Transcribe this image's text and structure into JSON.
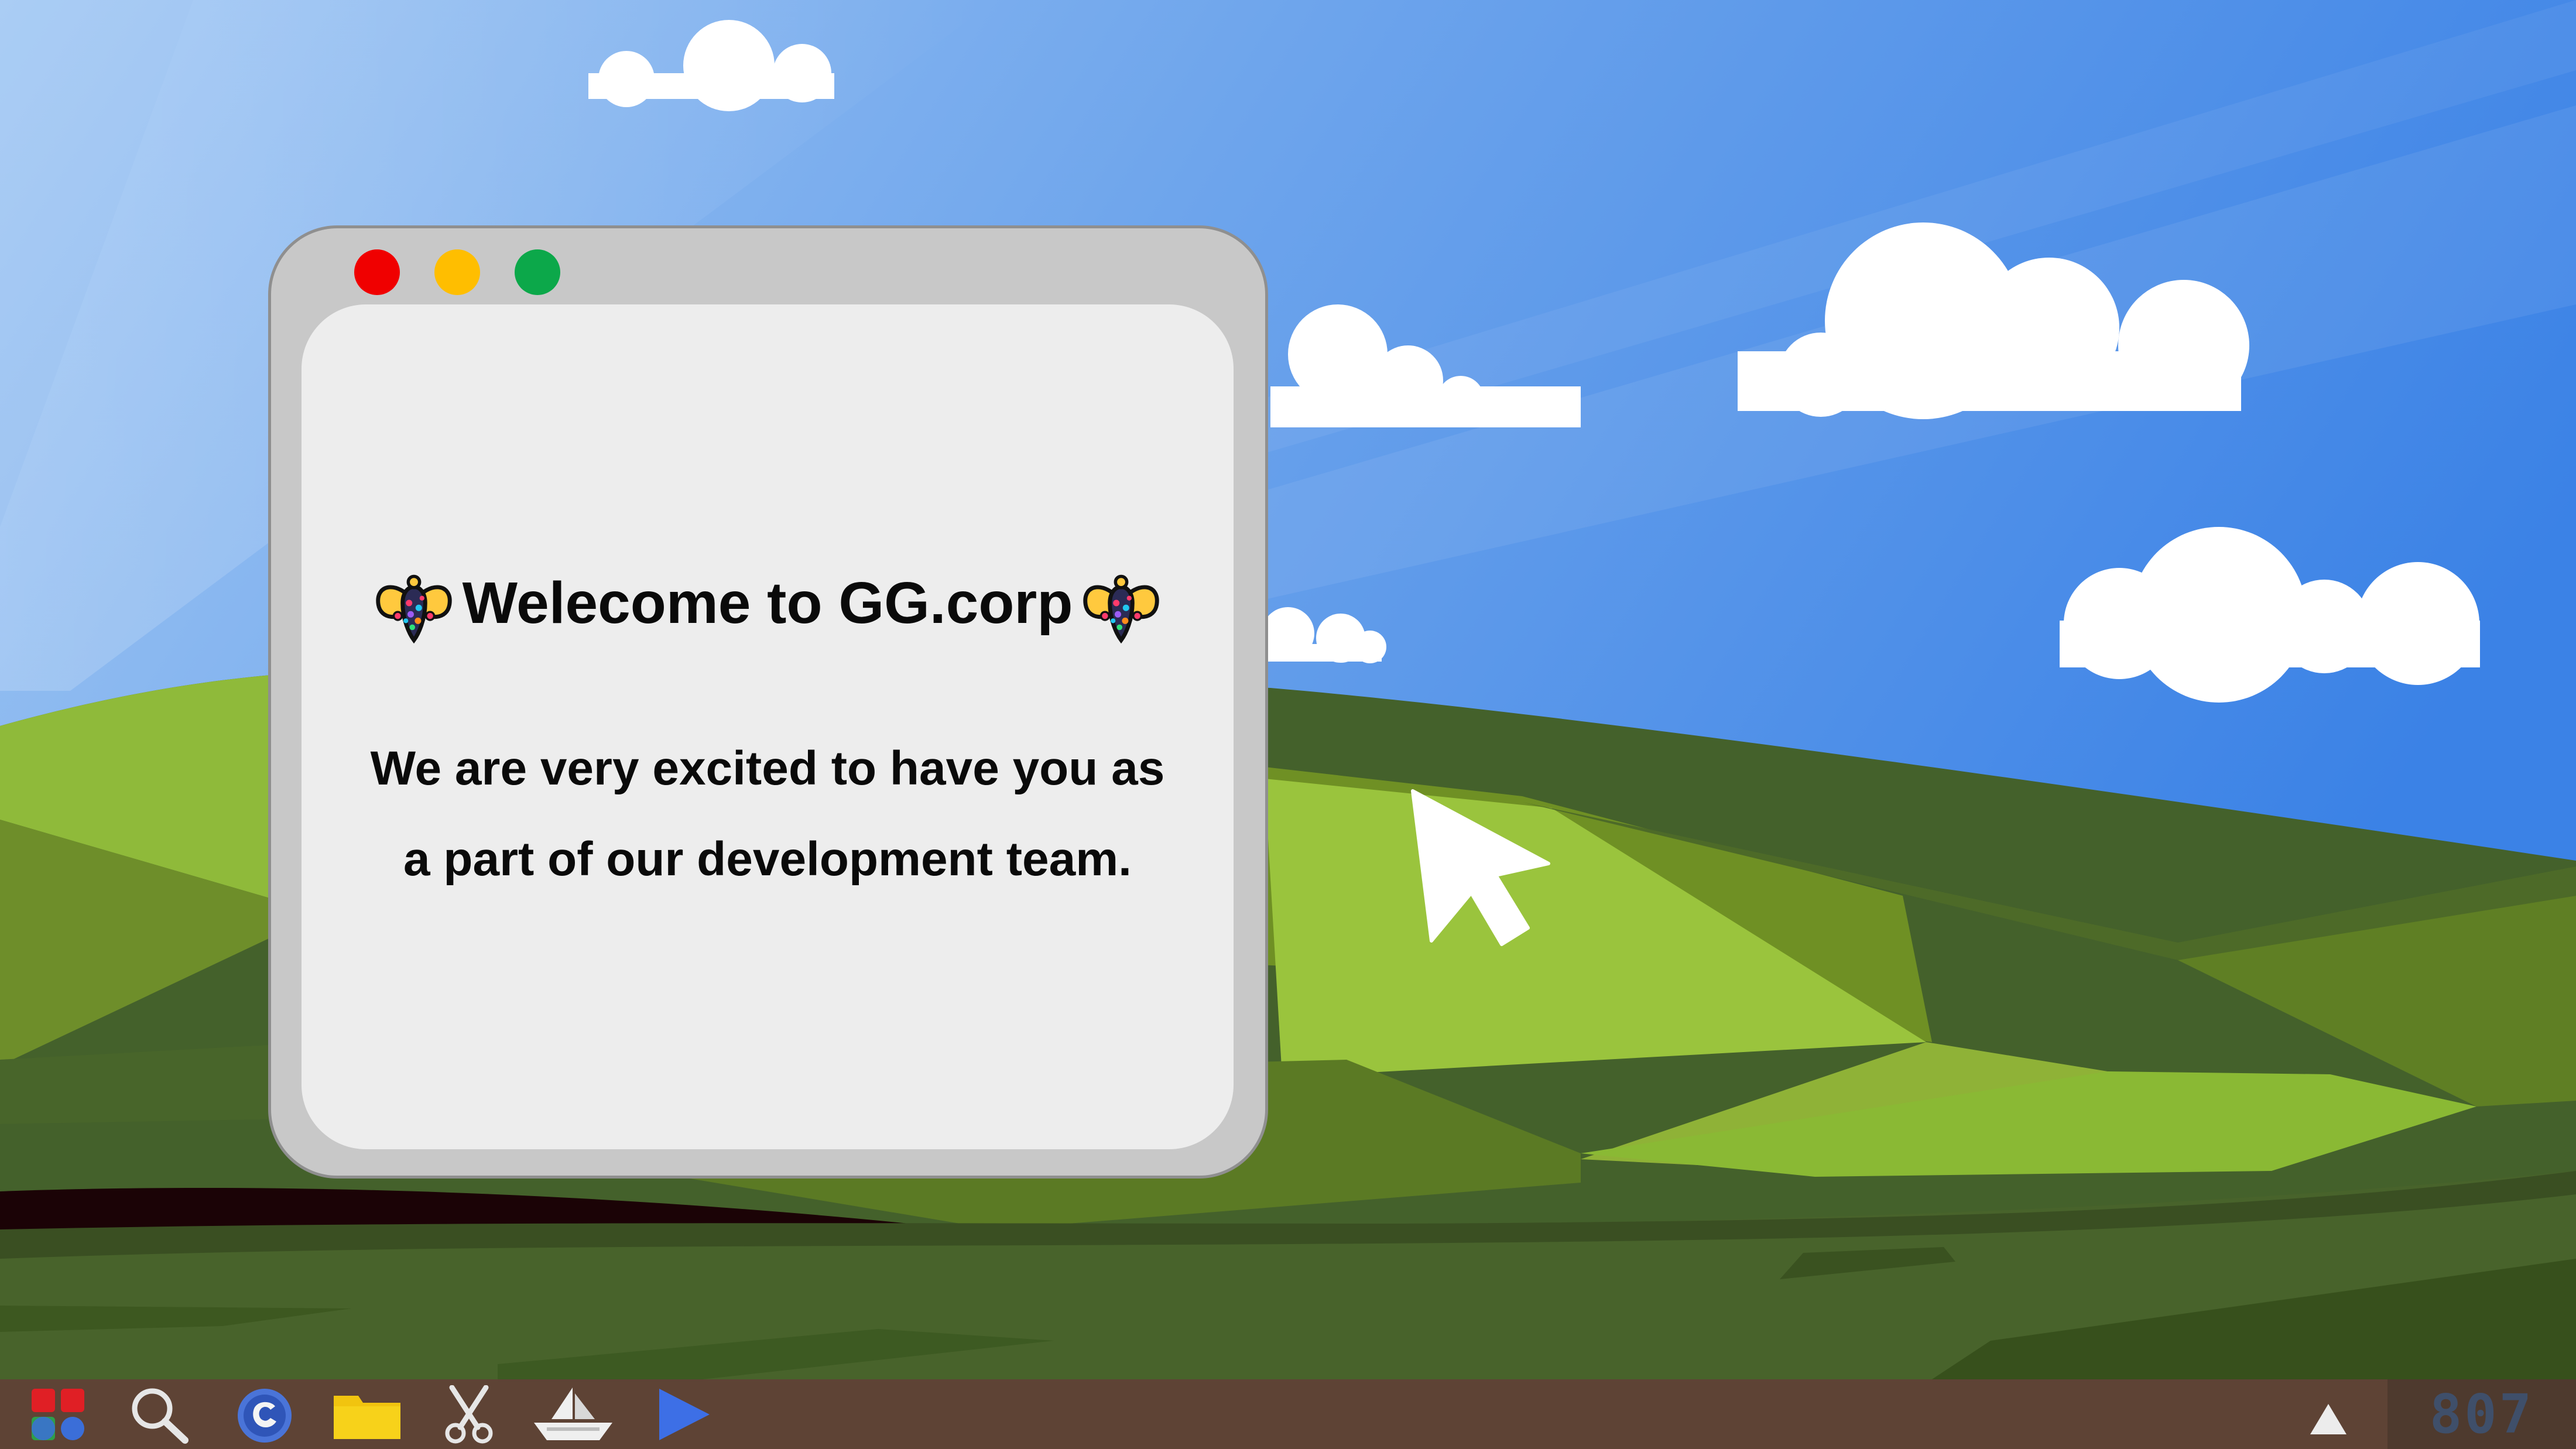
{
  "window": {
    "title_text": "Welecome to GG.corp",
    "message_line_1": "We are very excited to have you as",
    "message_line_2": "a part of our development team.",
    "title_icon": "bee-icon"
  },
  "traffic_lights": {
    "close_color": "#f00000",
    "minimize_color": "#ffbe00",
    "maximize_color": "#0ca84a"
  },
  "taskbar": {
    "icons": [
      "apps-grid-icon",
      "search-icon",
      "browser-icon",
      "folder-icon",
      "scissors-icon",
      "boat-icon",
      "play-icon"
    ],
    "tray_icon": "triangle-up-icon",
    "clock": "807"
  },
  "colors": {
    "sky": "#3f7fe0",
    "taskbar": "#5e4335",
    "window_frame": "#c8c8c8",
    "window_body": "#ededed"
  }
}
